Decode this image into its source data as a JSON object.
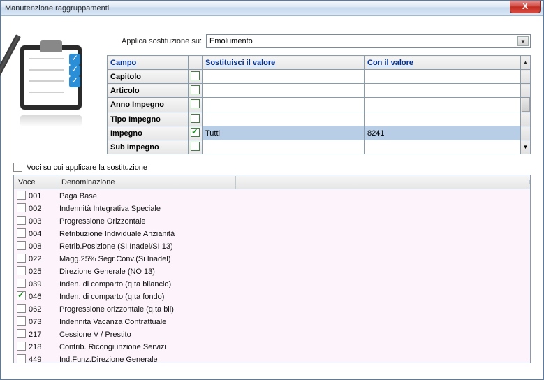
{
  "window": {
    "title": "Manutenzione raggruppamenti"
  },
  "apply": {
    "label": "Applica sostituzione su:",
    "selected": "Emolumento"
  },
  "sub_table": {
    "headers": {
      "campo": "Campo",
      "sostituisci": "Sostituisci il valore",
      "conil": "Con il valore"
    },
    "rows": [
      {
        "campo": "Capitolo",
        "checked": false,
        "sost": "",
        "conil": ""
      },
      {
        "campo": "Articolo",
        "checked": false,
        "sost": "",
        "conil": ""
      },
      {
        "campo": "Anno Impegno",
        "checked": false,
        "sost": "",
        "conil": ""
      },
      {
        "campo": "Tipo Impegno",
        "checked": false,
        "sost": "",
        "conil": ""
      },
      {
        "campo": "Impegno",
        "checked": true,
        "sost": "Tutti",
        "conil": "8241",
        "active": true
      },
      {
        "campo": "Sub Impegno",
        "checked": false,
        "sost": "",
        "conil": ""
      }
    ]
  },
  "voci": {
    "section_label": "Voci su cui applicare la sostituzione",
    "headers": {
      "voce": "Voce",
      "denom": "Denominazione"
    },
    "rows": [
      {
        "code": "001",
        "label": "Paga Base",
        "checked": false
      },
      {
        "code": "002",
        "label": "Indennità Integrativa Speciale",
        "checked": false
      },
      {
        "code": "003",
        "label": "Progressione Orizzontale",
        "checked": false
      },
      {
        "code": "004",
        "label": "Retribuzione Individuale Anzianità",
        "checked": false
      },
      {
        "code": "008",
        "label": "Retrib.Posizione (SI Inadel/SI 13)",
        "checked": false
      },
      {
        "code": "022",
        "label": "Magg.25% Segr.Conv.(Si Inadel)",
        "checked": false
      },
      {
        "code": "025",
        "label": "Direzione Generale (NO 13)",
        "checked": false
      },
      {
        "code": "039",
        "label": "Inden. di comparto (q.ta bilancio)",
        "checked": false
      },
      {
        "code": "046",
        "label": "Inden. di comparto (q.ta fondo)",
        "checked": true
      },
      {
        "code": "062",
        "label": "Progressione orizzontale (q.ta bil)",
        "checked": false
      },
      {
        "code": "073",
        "label": "Indennità Vacanza Contrattuale",
        "checked": false
      },
      {
        "code": "217",
        "label": "Cessione V / Prestito",
        "checked": false
      },
      {
        "code": "218",
        "label": "Contrib. Ricongiunzione Servizi",
        "checked": false
      },
      {
        "code": "449",
        "label": "Ind.Funz.Direzione Generale",
        "checked": false
      }
    ]
  }
}
